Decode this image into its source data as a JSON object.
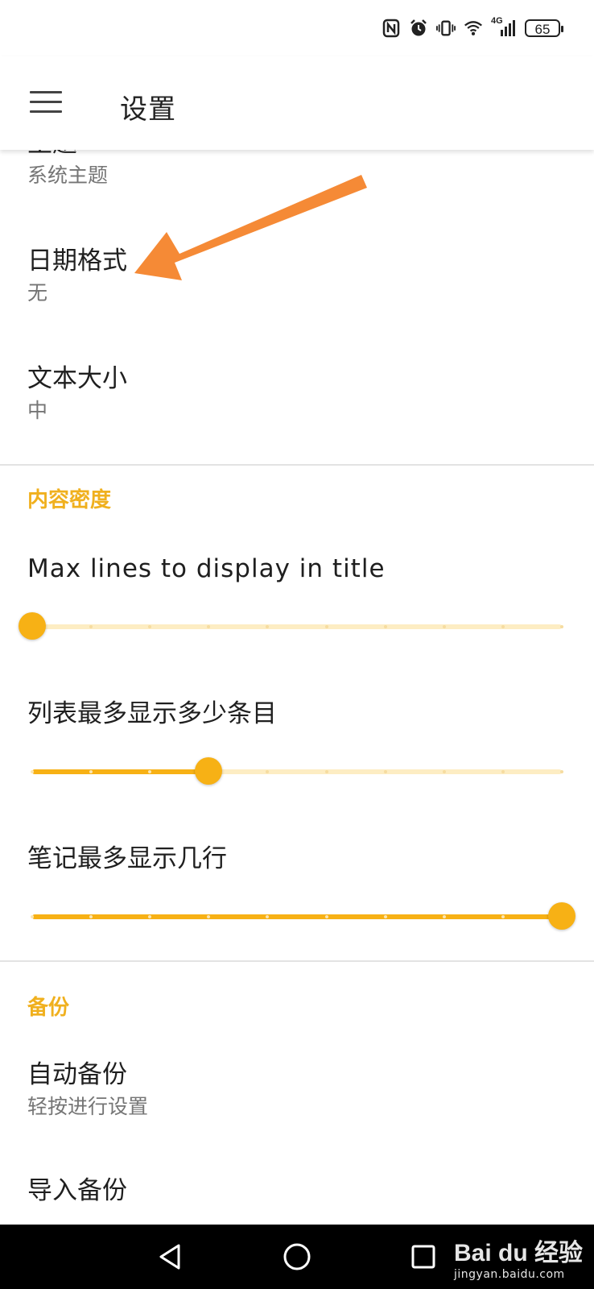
{
  "status_bar": {
    "icons": [
      "nfc-icon",
      "alarm-icon",
      "vibrate-icon",
      "wifi-icon",
      "signal-4g-icon"
    ],
    "signal_label": "4G",
    "battery": "65"
  },
  "app_bar": {
    "title": "设置"
  },
  "preferences": {
    "theme": {
      "title": "主题",
      "value": "系统主题"
    },
    "date_format": {
      "title": "日期格式",
      "value": "无"
    },
    "text_size": {
      "title": "文本大小",
      "value": "中"
    }
  },
  "density": {
    "header": "内容密度",
    "sliders": [
      {
        "title": "Max lines to display in title",
        "steps": 10,
        "value_fraction": 0.0
      },
      {
        "title": "列表最多显示多少条目",
        "steps": 10,
        "value_fraction": 0.333
      },
      {
        "title": "笔记最多显示几行",
        "steps": 10,
        "value_fraction": 1.0
      }
    ]
  },
  "backup": {
    "header": "备份",
    "auto": {
      "title": "自动备份",
      "value": "轻按进行设置"
    },
    "import": {
      "title": "导入备份"
    }
  },
  "annotation": {
    "arrow_color": "#f58a36"
  },
  "colors": {
    "accent": "#f7b115",
    "category": "#f0b01e"
  },
  "watermark": {
    "main": "Bai du 经验",
    "sub": "jingyan.baidu.com"
  }
}
